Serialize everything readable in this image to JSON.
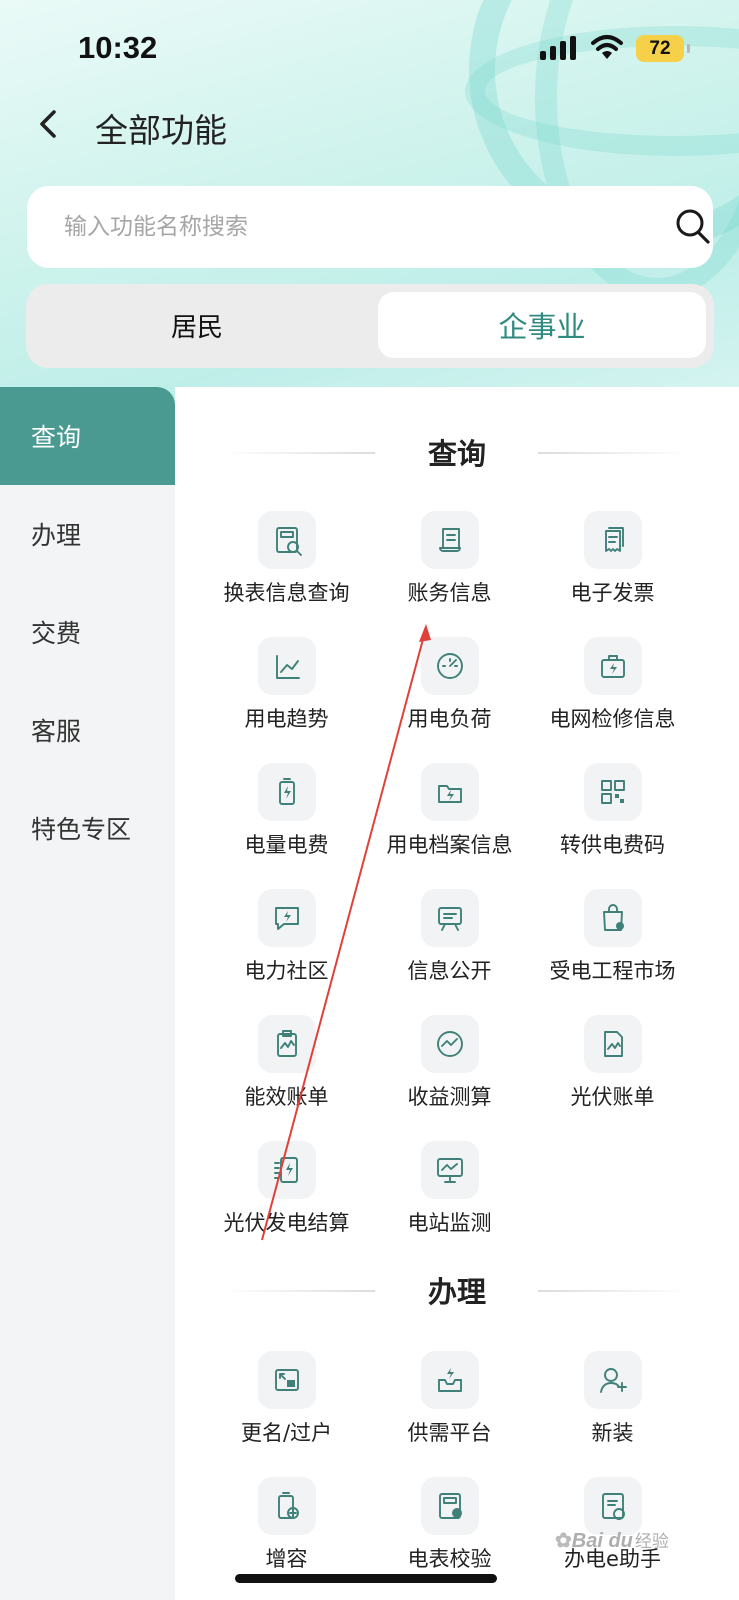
{
  "status_bar": {
    "time": "10:32",
    "battery": "72"
  },
  "header": {
    "title": "全部功能"
  },
  "search": {
    "placeholder": "输入功能名称搜索"
  },
  "segment": {
    "tabs": [
      "居民",
      "企事业"
    ],
    "active": "企事业"
  },
  "sidebar": {
    "items": [
      "查询",
      "办理",
      "交费",
      "客服",
      "特色专区"
    ],
    "active": "查询"
  },
  "sections": [
    {
      "title": "查询",
      "items": [
        {
          "label": "换表信息查询",
          "icon": "meter-search-icon"
        },
        {
          "label": "账务信息",
          "icon": "scroll-icon"
        },
        {
          "label": "电子发票",
          "icon": "invoice-icon"
        },
        {
          "label": "用电趋势",
          "icon": "trend-chart-icon"
        },
        {
          "label": "用电负荷",
          "icon": "gauge-icon"
        },
        {
          "label": "电网检修信息",
          "icon": "toolbox-bolt-icon"
        },
        {
          "label": "电量电费",
          "icon": "battery-bolt-icon"
        },
        {
          "label": "用电档案信息",
          "icon": "folder-bolt-icon"
        },
        {
          "label": "转供电费码",
          "icon": "qr-code-icon"
        },
        {
          "label": "电力社区",
          "icon": "chat-bolt-icon"
        },
        {
          "label": "信息公开",
          "icon": "board-icon"
        },
        {
          "label": "受电工程市场",
          "icon": "bag-gear-icon"
        },
        {
          "label": "能效账单",
          "icon": "clipboard-wave-icon"
        },
        {
          "label": "收益测算",
          "icon": "cycle-chart-icon"
        },
        {
          "label": "光伏账单",
          "icon": "doc-wave-icon"
        },
        {
          "label": "光伏发电结算",
          "icon": "list-bolt-icon"
        },
        {
          "label": "电站监测",
          "icon": "monitor-chart-icon"
        }
      ]
    },
    {
      "title": "办理",
      "items": [
        {
          "label": "更名/过户",
          "icon": "transfer-icon"
        },
        {
          "label": "供需平台",
          "icon": "tray-bolt-icon"
        },
        {
          "label": "新装",
          "icon": "user-add-icon"
        },
        {
          "label": "增容",
          "icon": "battery-plus-icon"
        },
        {
          "label": "电表校验",
          "icon": "meter-check-icon"
        },
        {
          "label": "办电e助手",
          "icon": "assistant-icon"
        }
      ]
    }
  ],
  "watermark": {
    "brand": "Bai du",
    "cn": "经验"
  },
  "colors": {
    "accent": "#4b9a92",
    "accent_text": "#2f8a7f",
    "icon_stroke": "#3f8078",
    "annotation_arrow": "#e0403a"
  }
}
